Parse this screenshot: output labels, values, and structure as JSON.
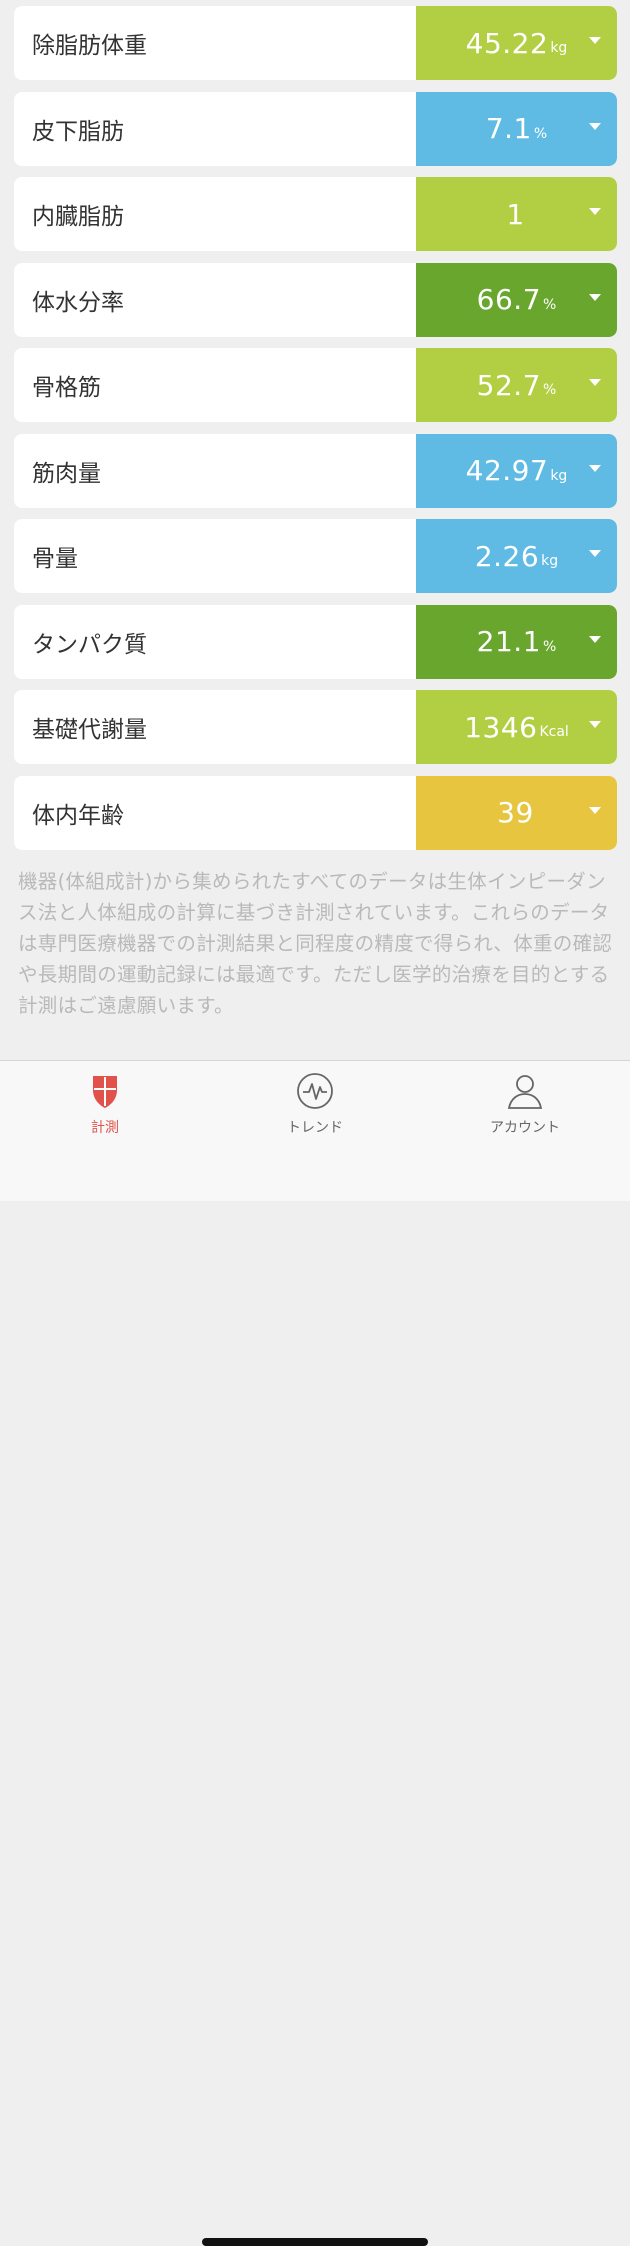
{
  "colors": {
    "light_green": "#b2cf44",
    "blue": "#5fbbe3",
    "dark_green": "#69a62e",
    "yellow": "#e8c53f",
    "accent_red": "#e0524a"
  },
  "metrics": [
    {
      "label": "除脂肪体重",
      "value": "45.22",
      "unit": "kg",
      "color": "#b2cf44"
    },
    {
      "label": "皮下脂肪",
      "value": "7.1",
      "unit": "%",
      "color": "#5fbbe3"
    },
    {
      "label": "内臓脂肪",
      "value": "1",
      "unit": "",
      "color": "#b2cf44"
    },
    {
      "label": "体水分率",
      "value": "66.7",
      "unit": "%",
      "color": "#69a62e"
    },
    {
      "label": "骨格筋",
      "value": "52.7",
      "unit": "%",
      "color": "#b2cf44"
    },
    {
      "label": "筋肉量",
      "value": "42.97",
      "unit": "kg",
      "color": "#5fbbe3"
    },
    {
      "label": "骨量",
      "value": "2.26",
      "unit": "kg",
      "color": "#5fbbe3"
    },
    {
      "label": "タンパク質",
      "value": "21.1",
      "unit": "%",
      "color": "#69a62e"
    },
    {
      "label": "基礎代謝量",
      "value": "1346",
      "unit": "Kcal",
      "color": "#b2cf44"
    },
    {
      "label": "体内年齢",
      "value": "39",
      "unit": "",
      "color": "#e8c53f"
    }
  ],
  "disclaimer": "機器(体組成計)から集められたすべてのデータは生体インピーダンス法と人体組成の計算に基づき計測されています。これらのデータは専門医療機器での計測結果と同程度の精度で得られ、体重の確認や長期間の運動記録には最適です。ただし医学的治療を目的とする計測はご遠慮願います。",
  "tabs": [
    {
      "label": "計測",
      "icon": "shield-icon",
      "active": true
    },
    {
      "label": "トレンド",
      "icon": "heartbeat-icon",
      "active": false
    },
    {
      "label": "アカウント",
      "icon": "person-icon",
      "active": false
    }
  ]
}
